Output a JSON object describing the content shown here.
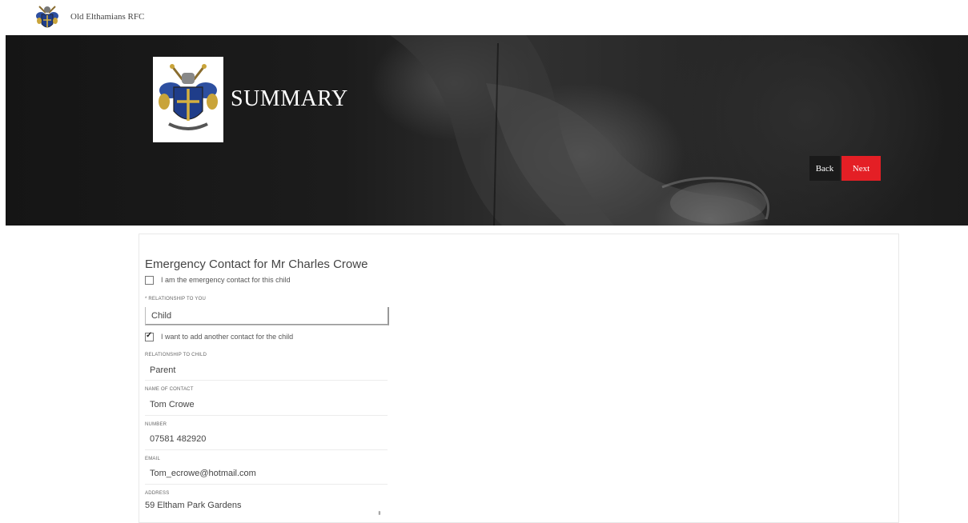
{
  "header": {
    "club_name": "Old Elthamians RFC"
  },
  "hero": {
    "title": "SUMMARY",
    "back_label": "Back",
    "next_label": "Next"
  },
  "form": {
    "section_title": "Emergency Contact for Mr Charles Crowe",
    "self_contact": {
      "label": "I am the emergency contact for this child",
      "checked": false
    },
    "relationship_to_you": {
      "label": "* RELATIONSHIP TO YOU",
      "value": "Child"
    },
    "add_another": {
      "label": "I want to add another contact for the child",
      "checked": true
    },
    "relationship_to_child": {
      "label": "RELATIONSHIP TO CHILD",
      "value": "Parent"
    },
    "contact_name": {
      "label": "NAME OF CONTACT",
      "value": "Tom Crowe"
    },
    "number": {
      "label": "NUMBER",
      "value": "07581 482920"
    },
    "email": {
      "label": "EMAIL",
      "value": "Tom_ecrowe@hotmail.com"
    },
    "address": {
      "label": "ADDRESS",
      "value": "59 Eltham Park Gardens"
    }
  },
  "colors": {
    "accent": "#e41f25",
    "back_button": "#1a1a1a",
    "hero_bg": "#1c1c1c"
  }
}
